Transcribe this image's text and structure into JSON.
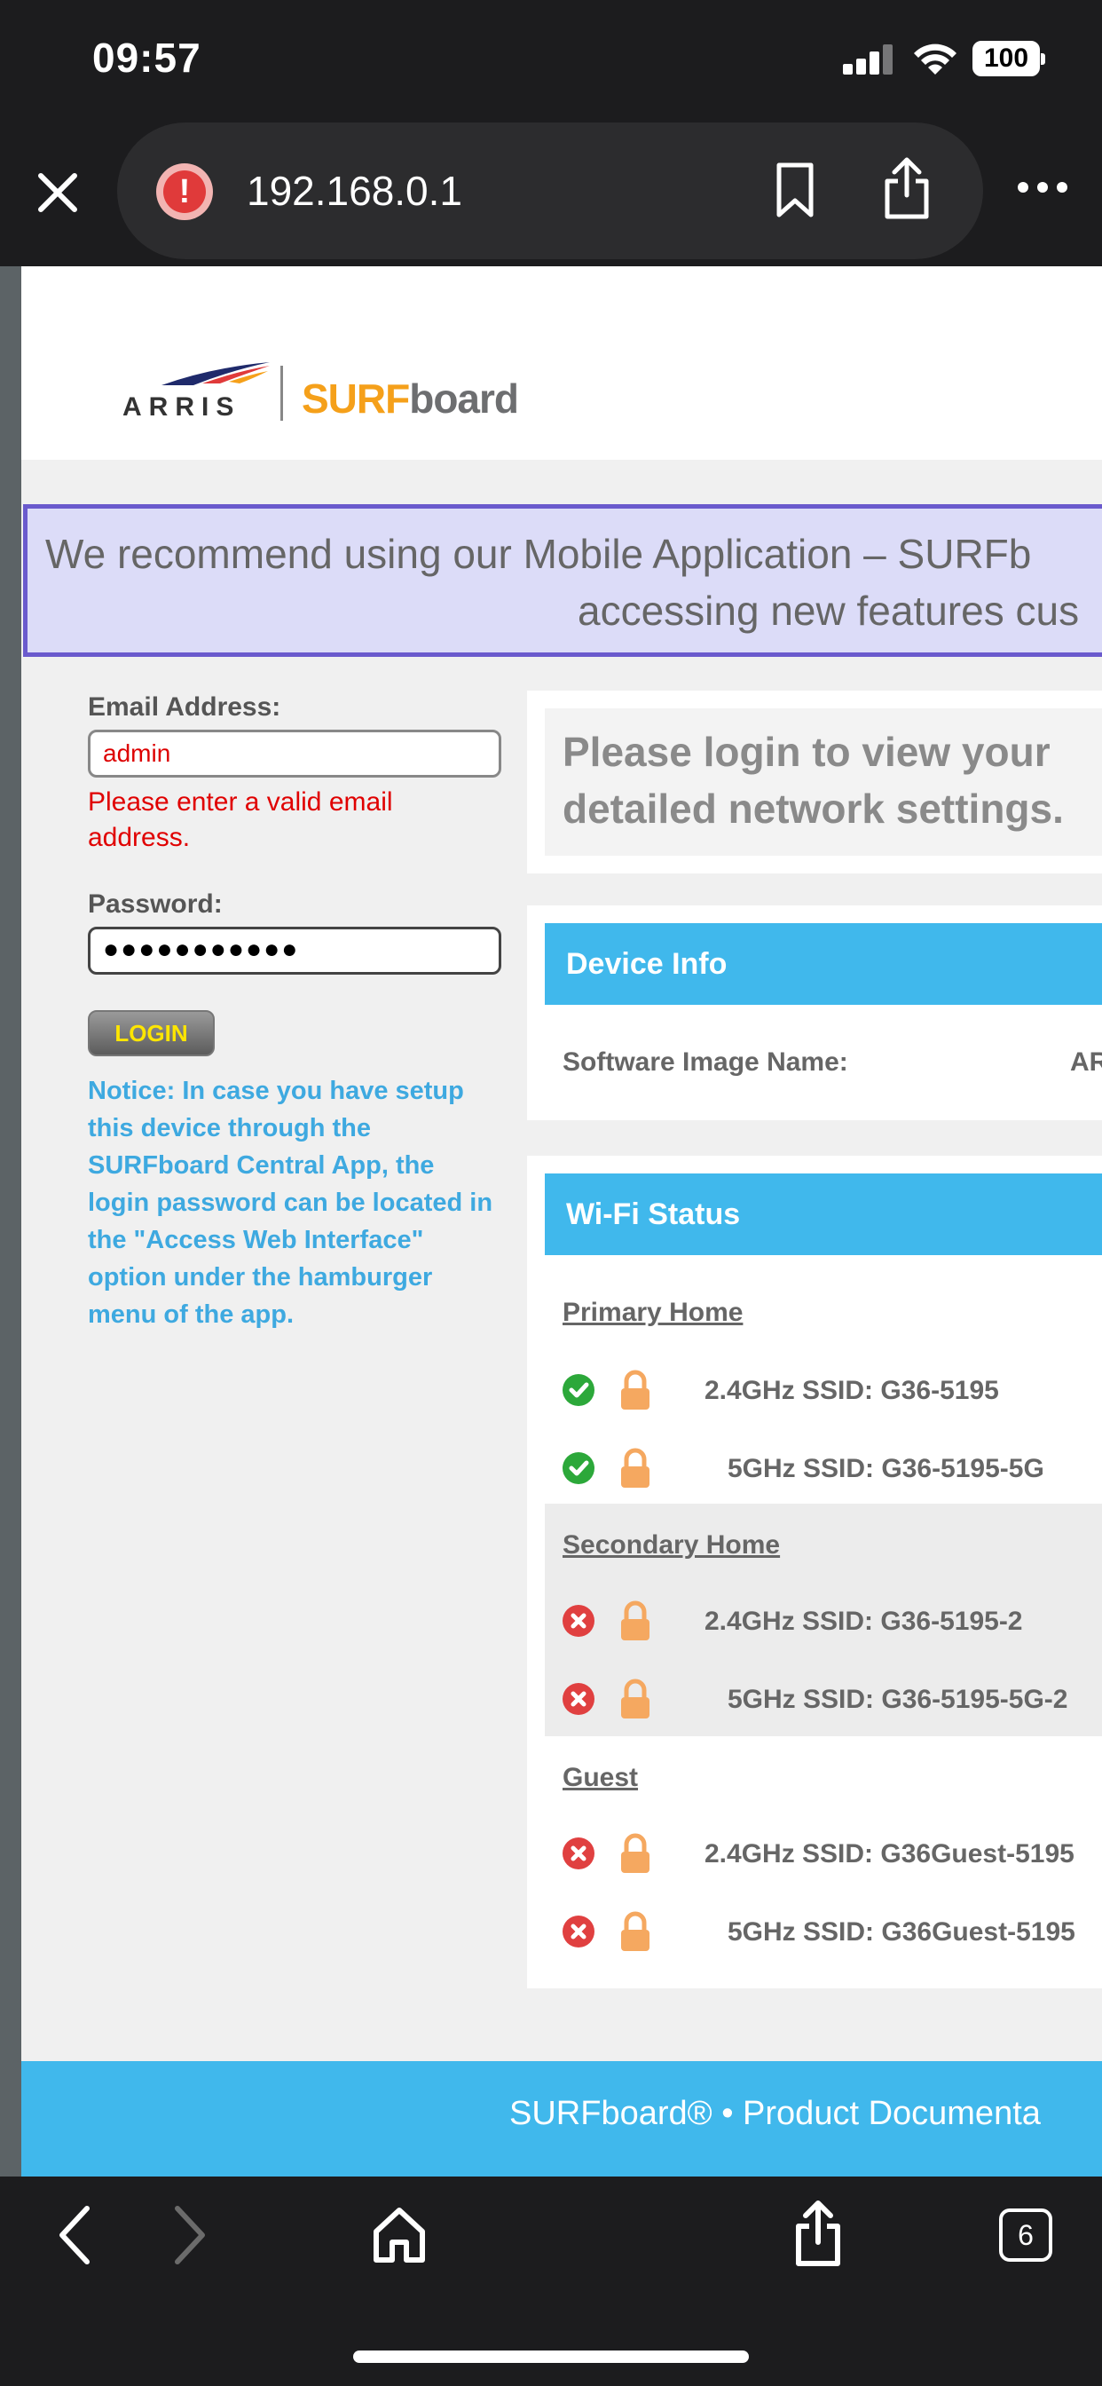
{
  "status_bar": {
    "time": "09:57",
    "battery": "100"
  },
  "browser": {
    "url": "192.168.0.1",
    "tabs_count": "6"
  },
  "header": {
    "logo_arris": "ARRIS",
    "logo_surf": "SURF",
    "logo_board": "board"
  },
  "banner": {
    "line1": "We recommend using our Mobile Application – SURFb",
    "line2": "accessing new features cus"
  },
  "login": {
    "email_label": "Email Address:",
    "email_value": "admin",
    "email_error": "Please enter a valid email address.",
    "password_label": "Password:",
    "password_value": "●●●●●●●●●●●",
    "login_button": "LOGIN",
    "notice": "Notice: In case you have setup this device through the SURFboard Central App, the login password can be located in the \"Access Web Interface\" option under the hamburger menu of the app."
  },
  "login_prompt": {
    "line1": "Please login to view your",
    "line2": "detailed network settings."
  },
  "device_info": {
    "title": "Device Info",
    "software_label": "Software Image Name:",
    "software_value": "AR"
  },
  "wifi_status": {
    "title": "Wi-Fi Status",
    "groups": [
      {
        "name": "Primary Home",
        "ssids": [
          {
            "label": "2.4GHz SSID: G36-5195",
            "status": "enabled"
          },
          {
            "label": "5GHz SSID: G36-5195-5G",
            "status": "enabled"
          }
        ]
      },
      {
        "name": "Secondary Home",
        "ssids": [
          {
            "label": "2.4GHz SSID: G36-5195-2",
            "status": "disabled"
          },
          {
            "label": "5GHz SSID: G36-5195-5G-2",
            "status": "disabled"
          }
        ]
      },
      {
        "name": "Guest",
        "ssids": [
          {
            "label": "2.4GHz SSID: G36Guest-5195",
            "status": "disabled"
          },
          {
            "label": "5GHz SSID: G36Guest-5195",
            "status": "disabled"
          }
        ]
      }
    ]
  },
  "footer": {
    "text": "SURFboard®  •  Product Documenta"
  },
  "colors": {
    "accent_blue": "#40b8ec",
    "brand_orange": "#f5a01a",
    "error_red": "#e00000",
    "ok_green": "#2ca83a",
    "banner_border": "#6a5acd"
  },
  "icons": [
    "close-icon",
    "warning-icon",
    "bookmark-icon",
    "share-icon",
    "more-icon",
    "back-icon",
    "forward-icon",
    "home-icon",
    "tabs-icon",
    "lock-icon",
    "check-icon",
    "x-icon"
  ]
}
